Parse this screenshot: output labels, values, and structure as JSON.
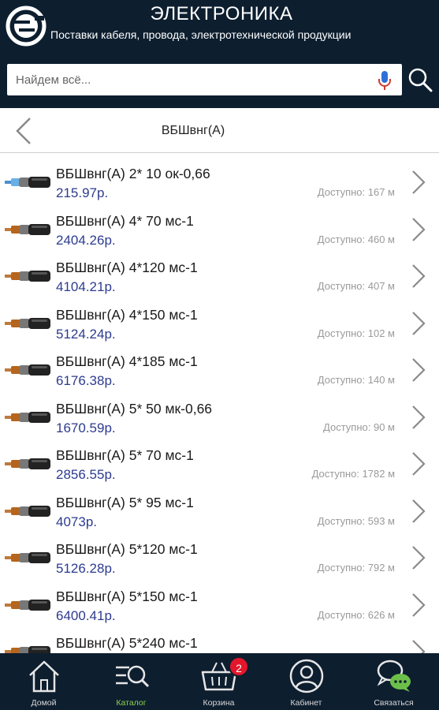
{
  "header": {
    "title": "ЭЛЕКТРОНИКА",
    "subtitle": "Поставки кабеля, провода, электротехнической продукции",
    "logo": "company-logo"
  },
  "search": {
    "placeholder": "Найдем всё...",
    "value": "",
    "mic_icon": "microphone-icon",
    "search_icon": "magnifier-icon"
  },
  "titlebar": {
    "back_icon": "chevron-left-icon",
    "title": "ВБШвнг(А)"
  },
  "items": [
    {
      "name": "ВБШвнг(А) 2* 10 ок-0,66",
      "price": "215.97р.",
      "availability": "Доступно: 167 м"
    },
    {
      "name": "ВБШвнг(А) 4* 70 мс-1",
      "price": "2404.26р.",
      "availability": "Доступно: 460 м"
    },
    {
      "name": "ВБШвнг(А) 4*120 мс-1",
      "price": "4104.21р.",
      "availability": "Доступно: 407 м"
    },
    {
      "name": "ВБШвнг(А) 4*150 мс-1",
      "price": "5124.24р.",
      "availability": "Доступно: 102 м"
    },
    {
      "name": "ВБШвнг(А) 4*185 мс-1",
      "price": "6176.38р.",
      "availability": "Доступно: 140 м"
    },
    {
      "name": "ВБШвнг(А) 5* 50 мк-0,66",
      "price": "1670.59р.",
      "availability": "Доступно: 90 м"
    },
    {
      "name": "ВБШвнг(А) 5* 70 мс-1",
      "price": "2856.55р.",
      "availability": "Доступно: 1782 м"
    },
    {
      "name": "ВБШвнг(А) 5* 95 мс-1",
      "price": "4073р.",
      "availability": "Доступно: 593 м"
    },
    {
      "name": "ВБШвнг(А) 5*120 мс-1",
      "price": "5126.28р.",
      "availability": "Доступно: 792 м"
    },
    {
      "name": "ВБШвнг(А) 5*150 мс-1",
      "price": "6400.41р.",
      "availability": "Доступно: 626 м"
    },
    {
      "name": "ВБШвнг(А) 5*240 мс-1",
      "price": "",
      "availability": ""
    }
  ],
  "nav": {
    "items": [
      {
        "label": "Домой",
        "icon": "home-icon"
      },
      {
        "label": "Каталог",
        "icon": "catalog-icon",
        "active": true
      },
      {
        "label": "Корзина",
        "icon": "basket-icon",
        "badge": "2"
      },
      {
        "label": "Кабинет",
        "icon": "user-icon"
      },
      {
        "label": "Связаться",
        "icon": "chat-icon"
      }
    ]
  },
  "colors": {
    "header_bg": "#0d1e2f",
    "price": "#2d3b8f",
    "active_nav": "#8dd34a",
    "badge": "#e3162b"
  }
}
